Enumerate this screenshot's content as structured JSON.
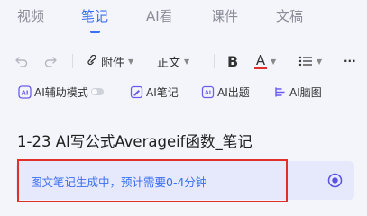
{
  "tabs": [
    {
      "label": "视频"
    },
    {
      "label": "笔记",
      "active": true
    },
    {
      "label": "AI看"
    },
    {
      "label": "课件"
    },
    {
      "label": "文稿"
    }
  ],
  "toolbar": {
    "attachment_label": "附件",
    "style_label": "正文",
    "bold_label": "B",
    "font_color_label": "A",
    "font_color": "#e0302a",
    "more_label": "···"
  },
  "ai_tools": {
    "assist_mode_label": "AI辅助模式",
    "ai_note_label": "AI笔记",
    "ai_quiz_label": "AI出题",
    "ai_mindmap_label": "AI脑图"
  },
  "note": {
    "title": "1-23 AI写公式Averageif函数_笔记"
  },
  "banner": {
    "text": "图文笔记生成中，预计需要0-4分钟"
  },
  "colors": {
    "accent": "#3a6ff5",
    "highlight": "#e0302a",
    "banner_bg": "#e6e8fb"
  }
}
